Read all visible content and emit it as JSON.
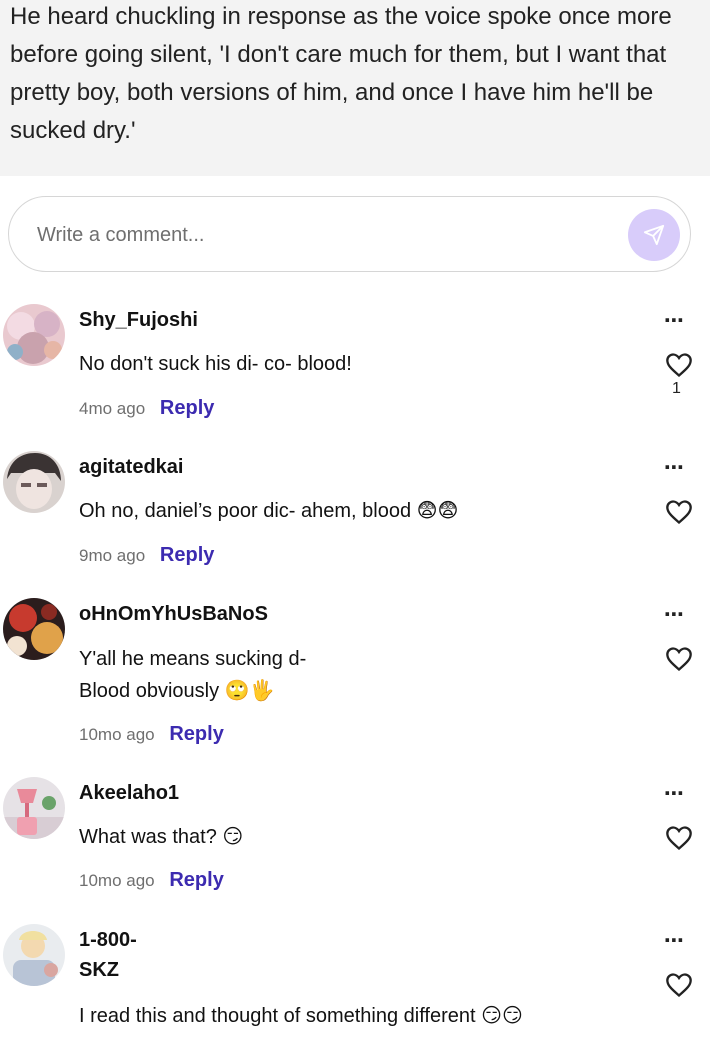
{
  "story": {
    "lines": [
      "He heard chuckling in response as the voice spoke once more",
      "before going silent, 'I don't care much for them, but I want that",
      "pretty boy, both versions of him, and once I have him he'll be",
      "sucked dry.'"
    ]
  },
  "comment_input": {
    "placeholder": "Write a comment...",
    "send_icon": "send-icon",
    "accent": "#d8ccfa"
  },
  "comments": [
    {
      "username": "Shy_Fujoshi",
      "text": "No don't suck his di- co- blood!",
      "time": "4mo ago",
      "reply_label": "Reply",
      "likes": "1"
    },
    {
      "username": "agitatedkai",
      "text": "Oh no, daniel’s poor dic- ahem, blood 😨😨",
      "time": "9mo ago",
      "reply_label": "Reply"
    },
    {
      "username": "oHnOmYhUsBaNoS",
      "text_line1": "Y'all he means sucking d-",
      "text_line2": "Blood obviously 🙄🖐",
      "time": "10mo ago",
      "reply_label": "Reply"
    },
    {
      "username": "Akeelaho1",
      "text": "What was that? 😏",
      "time": "10mo ago",
      "reply_label": "Reply"
    },
    {
      "username_line1": "1-800-",
      "username_line2": "SKZ",
      "text": "I read this and thought of something different 😏😏"
    }
  ],
  "colors": {
    "reply": "#3c2bb0",
    "story_bg": "#f3f3f3"
  },
  "more_icon": "⋯"
}
